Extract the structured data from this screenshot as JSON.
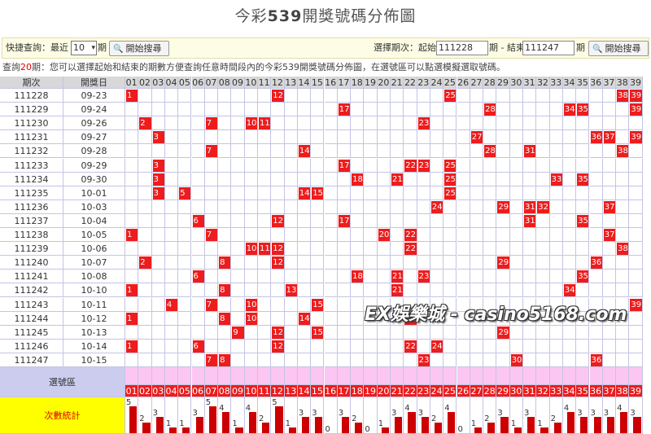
{
  "title": {
    "prefix": "今彩",
    "bold": "539",
    "suffix": "開獎號碼分佈圖"
  },
  "search": {
    "quick_label": "快捷查詢：最近",
    "recent_value": "10",
    "period_unit": "期",
    "search_button": "開始搜尋",
    "select_label": "選擇期次：起始",
    "start_value": "111228",
    "mid_label": "期 - 結束",
    "end_value": "111247",
    "end_unit": "期",
    "search_button2": "開始搜尋"
  },
  "notice": {
    "pre": "查詢",
    "count": "20",
    "post": "期：您可以選擇起始和結束的期數方便查詢任意時間段內的今彩539開獎號碼分佈圖，在選號區可以點選模擬選取號碼。"
  },
  "table": {
    "col_period": "期次",
    "col_date": "開獎日",
    "numbers": [
      "01",
      "02",
      "03",
      "04",
      "05",
      "06",
      "07",
      "08",
      "09",
      "10",
      "11",
      "12",
      "13",
      "14",
      "15",
      "16",
      "17",
      "18",
      "19",
      "20",
      "21",
      "22",
      "23",
      "24",
      "25",
      "26",
      "27",
      "28",
      "29",
      "30",
      "31",
      "32",
      "33",
      "34",
      "35",
      "36",
      "37",
      "38",
      "39"
    ],
    "rows": [
      {
        "period": "111228",
        "date": "09-23",
        "hits": [
          1,
          12,
          25,
          38,
          39
        ]
      },
      {
        "period": "111229",
        "date": "09-24",
        "hits": [
          17,
          28,
          34,
          35,
          39
        ]
      },
      {
        "period": "111230",
        "date": "09-26",
        "hits": [
          2,
          7,
          10,
          11,
          23
        ]
      },
      {
        "period": "111231",
        "date": "09-27",
        "hits": [
          3,
          27,
          36,
          37,
          39
        ]
      },
      {
        "period": "111232",
        "date": "09-28",
        "hits": [
          7,
          14,
          28,
          31,
          38
        ]
      },
      {
        "period": "111233",
        "date": "09-29",
        "hits": [
          3,
          17,
          22,
          23,
          25
        ]
      },
      {
        "period": "111234",
        "date": "09-30",
        "hits": [
          3,
          18,
          21,
          25,
          33,
          35
        ]
      },
      {
        "period": "111235",
        "date": "10-01",
        "hits": [
          3,
          5,
          14,
          15,
          25
        ]
      },
      {
        "period": "111236",
        "date": "10-03",
        "hits": [
          24,
          29,
          31,
          32,
          37
        ]
      },
      {
        "period": "111237",
        "date": "10-04",
        "hits": [
          6,
          12,
          17,
          31,
          35
        ]
      },
      {
        "period": "111238",
        "date": "10-05",
        "hits": [
          1,
          7,
          20,
          22,
          37
        ]
      },
      {
        "period": "111239",
        "date": "10-06",
        "hits": [
          10,
          11,
          12,
          22,
          38
        ]
      },
      {
        "period": "111240",
        "date": "10-07",
        "hits": [
          2,
          8,
          12,
          29,
          36
        ]
      },
      {
        "period": "111241",
        "date": "10-08",
        "hits": [
          6,
          18,
          21,
          23,
          35
        ]
      },
      {
        "period": "111242",
        "date": "10-10",
        "hits": [
          1,
          8,
          13,
          21,
          34
        ]
      },
      {
        "period": "111243",
        "date": "10-11",
        "hits": [
          4,
          7,
          10,
          15,
          39
        ]
      },
      {
        "period": "111244",
        "date": "10-12",
        "hits": [
          1,
          8,
          10,
          14,
          22
        ]
      },
      {
        "period": "111245",
        "date": "10-13",
        "hits": [
          9,
          12,
          15,
          29
        ]
      },
      {
        "period": "111246",
        "date": "10-14",
        "hits": [
          1,
          6,
          12,
          22,
          24
        ]
      },
      {
        "period": "111247",
        "date": "10-15",
        "hits": [
          7,
          8,
          23,
          30,
          36
        ]
      }
    ],
    "select_area_label": "選號區",
    "stats_label": "次數統計",
    "stats": [
      5,
      2,
      3,
      1,
      1,
      3,
      5,
      4,
      1,
      4,
      2,
      5,
      1,
      3,
      3,
      0,
      3,
      2,
      0,
      1,
      3,
      4,
      3,
      2,
      4,
      0,
      1,
      2,
      3,
      1,
      3,
      1,
      2,
      4,
      3,
      3,
      3,
      4,
      3
    ]
  },
  "watermark": "EX娛樂城 - casino5168.com",
  "colors": {
    "hit": "#ee1c1c",
    "bar": "#cc0000",
    "header": "#d8d8d8",
    "pink": "#fcc6f2",
    "yellow": "#ffff00",
    "grid": "#c4c4e4"
  }
}
